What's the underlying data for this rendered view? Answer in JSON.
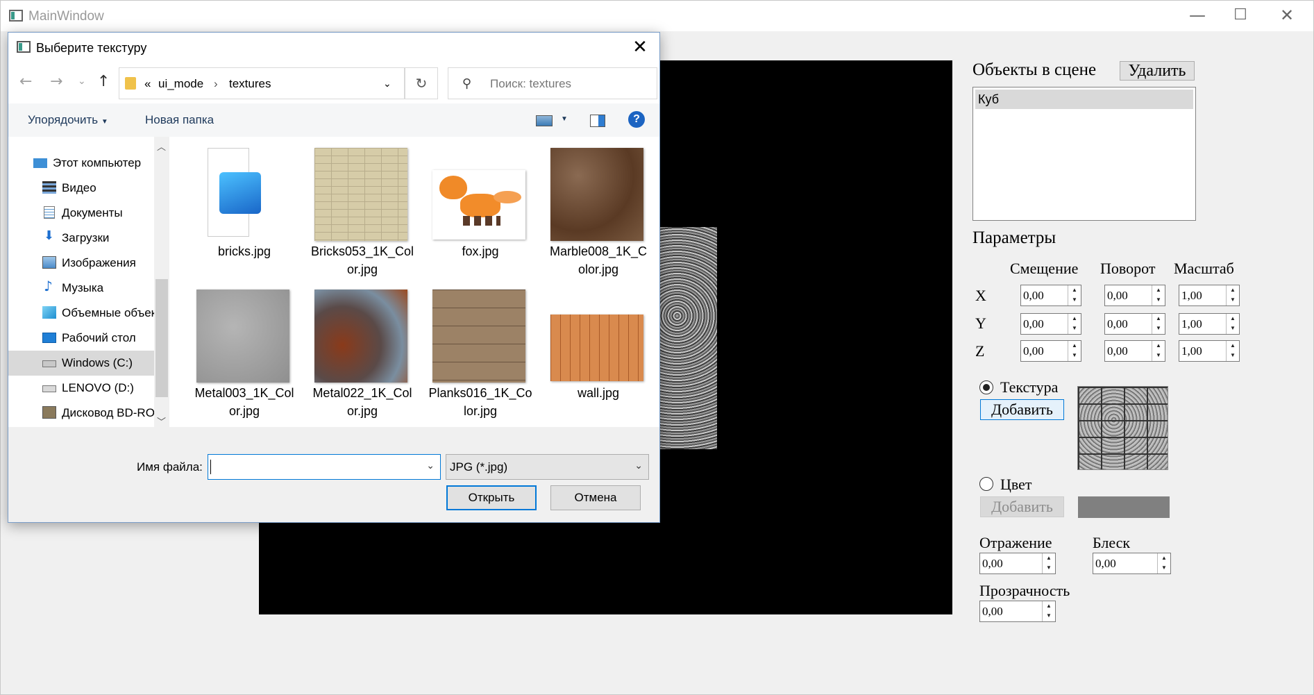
{
  "main_window": {
    "title": "MainWindow",
    "minimize": "—",
    "maximize": "☐",
    "close": "✕"
  },
  "scene_panel": {
    "objects_title": "Объекты в сцене",
    "delete_button": "Удалить",
    "objects": [
      "Куб"
    ],
    "params_title": "Параметры",
    "col_offset": "Смещение",
    "col_rotation": "Поворот",
    "col_scale": "Масштаб",
    "rows": [
      {
        "axis": "X",
        "offset": "0,00",
        "rotation": "0,00",
        "scale": "1,00"
      },
      {
        "axis": "Y",
        "offset": "0,00",
        "rotation": "0,00",
        "scale": "1,00"
      },
      {
        "axis": "Z",
        "offset": "0,00",
        "rotation": "0,00",
        "scale": "1,00"
      }
    ],
    "texture_radio": "Текстура",
    "texture_add": "Добавить",
    "color_radio": "Цвет",
    "color_add": "Добавить",
    "color_value": "#808080",
    "reflection_label": "Отражение",
    "reflection_value": "0,00",
    "shine_label": "Блеск",
    "shine_value": "0,00",
    "transparency_label": "Прозрачность",
    "transparency_value": "0,00"
  },
  "dialog": {
    "title": "Выберите текстуру",
    "close": "✕",
    "back": "←",
    "forward": "→",
    "recent": "⌄",
    "up": "↑",
    "breadcrumb_overflow": "«",
    "path_segments": [
      "ui_mode",
      "textures"
    ],
    "path_separator": "›",
    "refresh": "↻",
    "search_placeholder": "Поиск: textures",
    "organize": "Упорядочить",
    "new_folder": "Новая папка",
    "sidebar": [
      {
        "label": "Этот компьютер",
        "icon": "computer-icon"
      },
      {
        "label": "Видео",
        "icon": "video-icon"
      },
      {
        "label": "Документы",
        "icon": "documents-icon"
      },
      {
        "label": "Загрузки",
        "icon": "downloads-icon"
      },
      {
        "label": "Изображения",
        "icon": "pictures-icon"
      },
      {
        "label": "Музыка",
        "icon": "music-icon"
      },
      {
        "label": "Объемные объекты",
        "icon": "3d-objects-icon"
      },
      {
        "label": "Рабочий стол",
        "icon": "desktop-icon"
      },
      {
        "label": "Windows (C:)",
        "icon": "drive-c-icon"
      },
      {
        "label": "LENOVO (D:)",
        "icon": "drive-d-icon"
      },
      {
        "label": "Дисковод BD-ROM",
        "icon": "bd-rom-icon"
      }
    ],
    "selected_sidebar": "Windows (C:)",
    "files": [
      {
        "line1": "bricks.jpg",
        "line2": ""
      },
      {
        "line1": "Bricks053_1K_Col",
        "line2": "or.jpg"
      },
      {
        "line1": "fox.jpg",
        "line2": ""
      },
      {
        "line1": "Marble008_1K_C",
        "line2": "olor.jpg"
      },
      {
        "line1": "Metal003_1K_Col",
        "line2": "or.jpg"
      },
      {
        "line1": "Metal022_1K_Col",
        "line2": "or.jpg"
      },
      {
        "line1": "Planks016_1K_Co",
        "line2": "lor.jpg"
      },
      {
        "line1": "wall.jpg",
        "line2": ""
      }
    ],
    "filename_label": "Имя файла:",
    "filename_value": "",
    "filter_value": "JPG (*.jpg)",
    "open_button": "Открыть",
    "cancel_button": "Отмена"
  }
}
